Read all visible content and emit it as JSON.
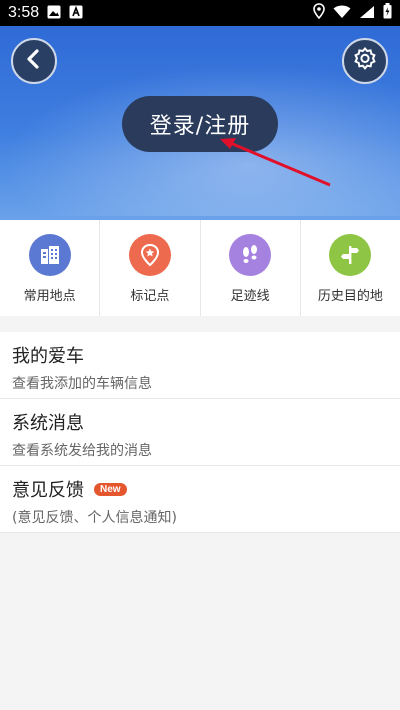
{
  "status_bar": {
    "time": "3:58",
    "left_icons": [
      "image-icon",
      "a-icon"
    ],
    "right_icons": [
      "location-icon",
      "wifi-icon",
      "signal-icon",
      "battery-icon"
    ]
  },
  "header": {
    "back_icon": "chevron-left-icon",
    "settings_icon": "gear-icon",
    "login_label": "登录/注册"
  },
  "quick_actions": [
    {
      "label": "常用地点",
      "icon": "building-icon",
      "color": "#5b79d2"
    },
    {
      "label": "标记点",
      "icon": "star-pin-icon",
      "color": "#ee6a4e"
    },
    {
      "label": "足迹线",
      "icon": "footprints-icon",
      "color": "#a682e0"
    },
    {
      "label": "历史目的地",
      "icon": "signpost-icon",
      "color": "#8fc545"
    }
  ],
  "menu": [
    {
      "title": "我的爱车",
      "subtitle": "查看我添加的车辆信息",
      "badge": ""
    },
    {
      "title": "系统消息",
      "subtitle": "查看系统发给我的消息",
      "badge": ""
    },
    {
      "title": "意见反馈",
      "subtitle": "(意见反馈、个人信息通知)",
      "badge": "New"
    }
  ]
}
